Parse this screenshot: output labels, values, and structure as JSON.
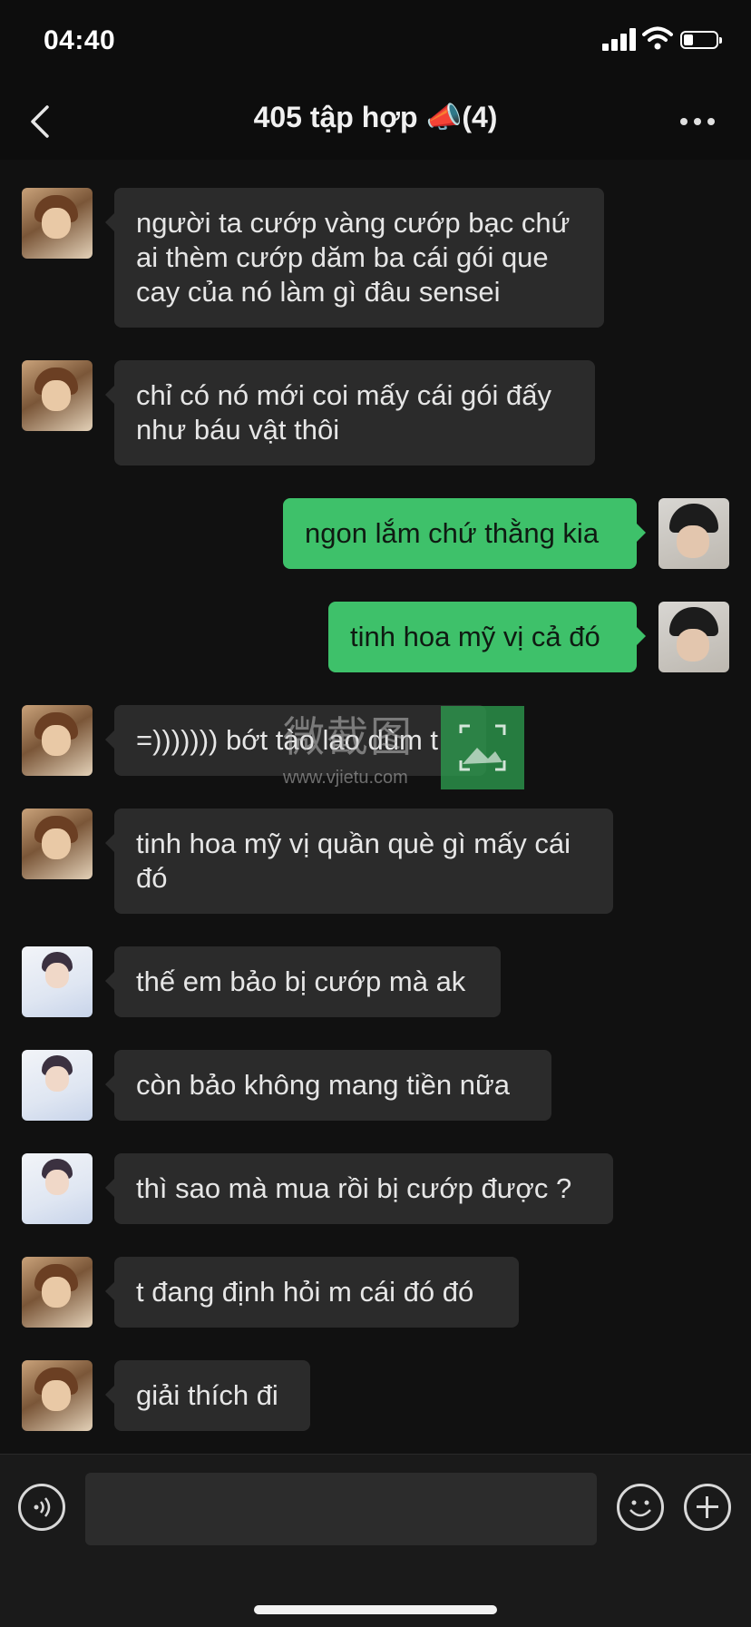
{
  "status_bar": {
    "time": "04:40",
    "battery_level": 0.3
  },
  "header": {
    "back_icon": "chevron-left-icon",
    "title": "405 tập hợp 📣(4)",
    "more_icon": "ellipsis-icon"
  },
  "messages": [
    {
      "sender": "friend-a",
      "direction": "in",
      "text": "người ta cướp vàng cướp bạc chứ\nai thèm cướp dăm ba cái gói que\ncay của nó làm gì đâu sensei"
    },
    {
      "sender": "friend-a",
      "direction": "in",
      "text": "chỉ có nó mới coi mấy cái gói đấy\nnhư báu vật thôi"
    },
    {
      "sender": "me",
      "direction": "out",
      "text": "ngon lắm chứ thằng kia"
    },
    {
      "sender": "me",
      "direction": "out",
      "text": "tinh hoa mỹ vị cả đó"
    },
    {
      "sender": "friend-a",
      "direction": "in",
      "text": "=))))))) bớt tào lao dùm t"
    },
    {
      "sender": "friend-a",
      "direction": "in",
      "text": "tinh hoa mỹ vị quần què gì mấy cái\nđó"
    },
    {
      "sender": "friend-b",
      "direction": "in",
      "text": "thế em bảo bị cướp mà ak"
    },
    {
      "sender": "friend-b",
      "direction": "in",
      "text": "còn bảo không mang tiền nữa"
    },
    {
      "sender": "friend-b",
      "direction": "in",
      "text": "thì sao mà mua rồi bị cướp được ?"
    },
    {
      "sender": "friend-a",
      "direction": "in",
      "text": "t đang định hỏi m cái đó đó"
    },
    {
      "sender": "friend-a",
      "direction": "in",
      "text": "giải thích đi"
    }
  ],
  "watermark": {
    "text": "微截图",
    "url": "www.vjietu.com"
  },
  "input_bar": {
    "voice_icon": "voice-icon",
    "emoji_icon": "emoji-icon",
    "plus_icon": "plus-icon",
    "value": ""
  },
  "colors": {
    "incoming_bubble": "#2b2b2b",
    "outgoing_bubble": "#3ec16a",
    "background": "#111111"
  }
}
